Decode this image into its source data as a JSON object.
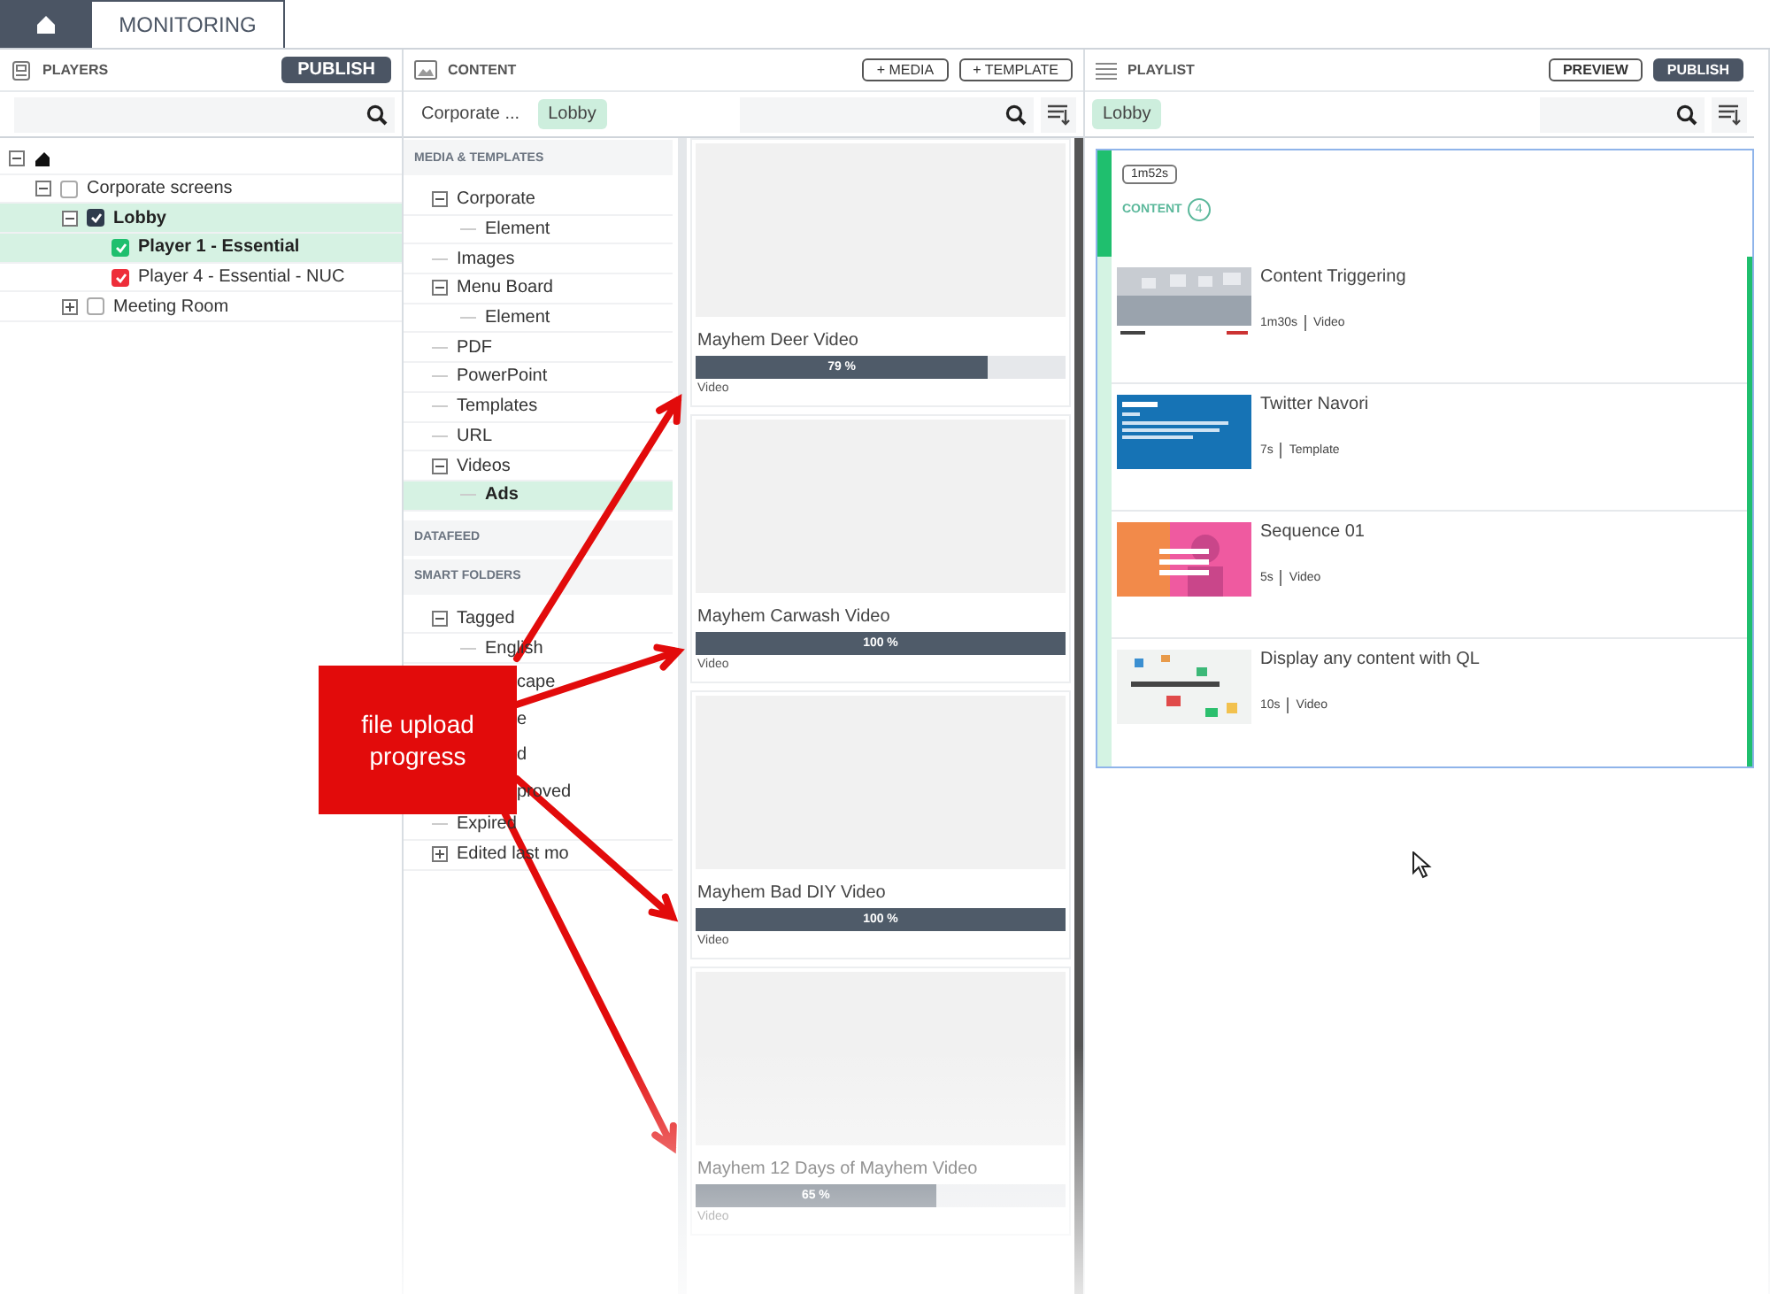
{
  "top_tabs": [
    {
      "kind": "home",
      "selected": false
    },
    {
      "kind": "text",
      "label": "MONITORING",
      "selected": true
    }
  ],
  "players": {
    "title": "PLAYERS",
    "publish": "PUBLISH",
    "tree": [
      {
        "kind": "root",
        "expanded": true,
        "children": [
          {
            "label": "Corporate screens",
            "expanded": true,
            "checked": false,
            "selected": false,
            "children": [
              {
                "label": "Lobby",
                "expanded": true,
                "checked": true,
                "color": "#2f3b4c",
                "selected": true,
                "children": [
                  {
                    "label": "Player 1 - Essential",
                    "checked": true,
                    "color": "#1fbf6e",
                    "selected": true
                  },
                  {
                    "label": "Player 4 - Essential - NUC",
                    "checked": true,
                    "color": "#ee2e3a",
                    "selected": false
                  }
                ]
              },
              {
                "label": "Meeting Room",
                "expanded": false,
                "checked": false,
                "selected": false
              }
            ]
          }
        ]
      }
    ]
  },
  "content": {
    "title": "CONTENT",
    "buttons": [
      "+ MEDIA",
      "+ TEMPLATE"
    ],
    "breadcrumbs": [
      {
        "label": "Corporate ...",
        "selected": false
      },
      {
        "label": "Lobby",
        "selected": true
      }
    ],
    "sections": [
      {
        "title": "MEDIA & TEMPLATES",
        "tree": [
          {
            "label": "Corporate",
            "expanded": true,
            "selected": false,
            "children": [
              {
                "label": "Element",
                "selected": false
              }
            ]
          },
          {
            "label": "Images",
            "selected": false
          },
          {
            "label": "Menu Board",
            "expanded": true,
            "selected": false,
            "children": [
              {
                "label": "Element",
                "selected": false
              }
            ]
          },
          {
            "label": "PDF",
            "selected": false
          },
          {
            "label": "PowerPoint",
            "selected": false
          },
          {
            "label": "Templates",
            "selected": false
          },
          {
            "label": "URL",
            "selected": false
          },
          {
            "label": "Videos",
            "expanded": true,
            "selected": false,
            "children": [
              {
                "label": "Ads",
                "selected": true
              }
            ]
          }
        ]
      },
      {
        "title": "DATAFEED"
      },
      {
        "title": "SMART FOLDERS",
        "tree": [
          {
            "label": "Tagged",
            "expanded": true,
            "selected": false,
            "children": [
              {
                "label": "English",
                "selected": false
              },
              {
                "label": "cape",
                "kind": "partial",
                "selected": false
              },
              {
                "label": "e",
                "kind": "partial",
                "selected": false
              },
              {
                "label": "d",
                "kind": "partial",
                "selected": false
              },
              {
                "label": "proved",
                "kind": "partial",
                "selected": false
              }
            ]
          },
          {
            "label": "Expired",
            "selected": false
          },
          {
            "label": "Edited last mo",
            "expanded": false,
            "selected": false
          }
        ]
      }
    ],
    "cards": [
      {
        "title": "Mayhem Deer Video",
        "level": 0.79,
        "reading": "79 %",
        "type": "Video"
      },
      {
        "title": "Mayhem Carwash Video",
        "level": 1,
        "reading": "100 %",
        "type": "Video"
      },
      {
        "title": "Mayhem Bad DIY Video",
        "level": 1,
        "reading": "100 %",
        "type": "Video"
      },
      {
        "title": "Mayhem 12 Days of Mayhem Video",
        "level": 0.65,
        "reading": "65 %",
        "type": "Video"
      }
    ]
  },
  "playlist": {
    "title": "PLAYLIST",
    "buttons": [
      {
        "label": "PREVIEW",
        "kind": "outline"
      },
      {
        "label": "PUBLISH",
        "kind": "solid"
      }
    ],
    "tags": [
      {
        "label": "Lobby",
        "selected": true
      }
    ],
    "group": {
      "duration": "1m52s",
      "label": "CONTENT",
      "count": "4",
      "items": [
        {
          "title": "Content Triggering",
          "duration": "1m30s",
          "type": "Video"
        },
        {
          "title": "Twitter Navori",
          "duration": "7s",
          "type": "Template"
        },
        {
          "title": "Sequence 01",
          "duration": "5s",
          "type": "Video"
        },
        {
          "title": "Display any content with QL",
          "duration": "10s",
          "type": "Video"
        }
      ]
    }
  },
  "callout": {
    "text": "file upload progress"
  }
}
